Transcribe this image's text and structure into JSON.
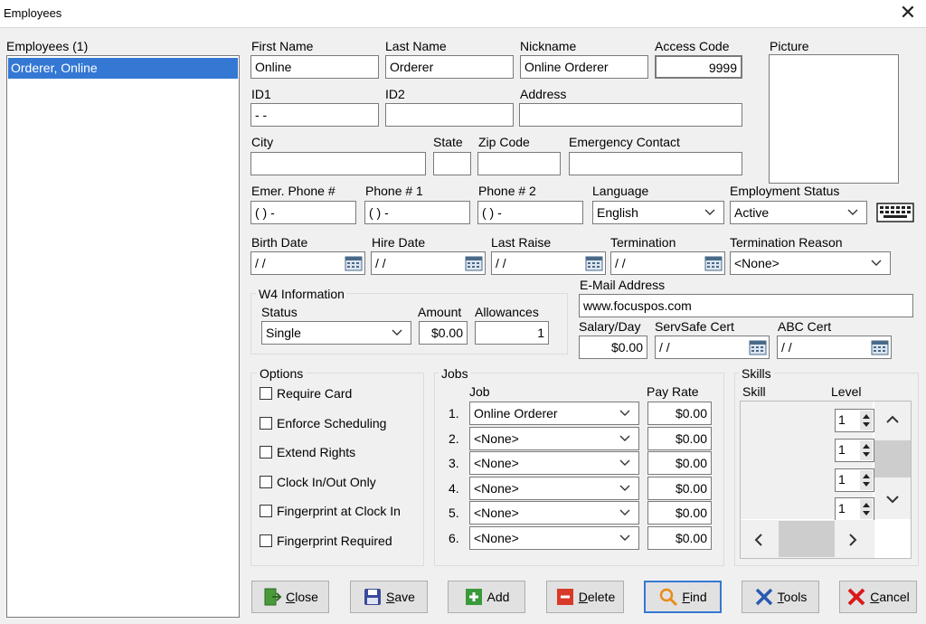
{
  "window": {
    "title": "Employees"
  },
  "employees_list": {
    "header": "Employees (1)",
    "items": [
      "Orderer, Online"
    ]
  },
  "form": {
    "first_name": {
      "label": "First Name",
      "value": "Online"
    },
    "last_name": {
      "label": "Last Name",
      "value": "Orderer"
    },
    "nickname": {
      "label": "Nickname",
      "value": "Online Orderer"
    },
    "access_code": {
      "label": "Access Code",
      "value": "9999"
    },
    "picture": {
      "label": "Picture"
    },
    "id1": {
      "label": "ID1",
      "value": " - -"
    },
    "id2": {
      "label": "ID2",
      "value": ""
    },
    "address": {
      "label": "Address",
      "value": ""
    },
    "city": {
      "label": "City",
      "value": ""
    },
    "state": {
      "label": "State",
      "value": ""
    },
    "zip": {
      "label": "Zip Code",
      "value": ""
    },
    "emergency_contact": {
      "label": "Emergency Contact",
      "value": ""
    },
    "emer_phone": {
      "label": "Emer. Phone #",
      "value": "(  )   -"
    },
    "phone1": {
      "label": "Phone # 1",
      "value": "(  )   -"
    },
    "phone2": {
      "label": "Phone # 2",
      "value": "(  )   -"
    },
    "language": {
      "label": "Language",
      "value": "English"
    },
    "employment_status": {
      "label": "Employment Status",
      "value": "Active"
    },
    "birth_date": {
      "label": "Birth Date",
      "value": " / /"
    },
    "hire_date": {
      "label": "Hire Date",
      "value": " / /"
    },
    "last_raise": {
      "label": "Last Raise",
      "value": " / /"
    },
    "termination": {
      "label": "Termination",
      "value": " / /"
    },
    "termination_reason": {
      "label": "Termination Reason",
      "value": "<None>"
    },
    "w4": {
      "title": "W4 Information",
      "status_label": "Status",
      "status_value": "Single",
      "amount_label": "Amount",
      "amount_value": "$0.00",
      "allowances_label": "Allowances",
      "allowances_value": "1"
    },
    "email": {
      "label": "E-Mail Address",
      "value": "www.focuspos.com"
    },
    "salary_day": {
      "label": "Salary/Day",
      "value": "$0.00"
    },
    "servsafe_cert": {
      "label": "ServSafe Cert",
      "value": " / /"
    },
    "abc_cert": {
      "label": "ABC Cert",
      "value": " / /"
    }
  },
  "options": {
    "title": "Options",
    "items": [
      "Require Card",
      "Enforce Scheduling",
      "Extend Rights",
      "Clock In/Out Only",
      "Fingerprint at Clock In",
      "Fingerprint Required"
    ]
  },
  "jobs": {
    "title": "Jobs",
    "job_header": "Job",
    "pay_header": "Pay Rate",
    "rows": [
      {
        "num": "1.",
        "job": "Online Orderer",
        "rate": "$0.00"
      },
      {
        "num": "2.",
        "job": "<None>",
        "rate": "$0.00"
      },
      {
        "num": "3.",
        "job": "<None>",
        "rate": "$0.00"
      },
      {
        "num": "4.",
        "job": "<None>",
        "rate": "$0.00"
      },
      {
        "num": "5.",
        "job": "<None>",
        "rate": "$0.00"
      },
      {
        "num": "6.",
        "job": "<None>",
        "rate": "$0.00"
      }
    ]
  },
  "skills": {
    "title": "Skills",
    "skill_header": "Skill",
    "level_header": "Level",
    "levels": [
      "1",
      "1",
      "1",
      "1"
    ]
  },
  "buttons": {
    "close": {
      "pre": "",
      "key": "C",
      "rest": "lose"
    },
    "save": {
      "pre": "",
      "key": "S",
      "rest": "ave"
    },
    "add": {
      "pre": "",
      "key": "",
      "rest": "Add"
    },
    "delete": {
      "pre": "",
      "key": "D",
      "rest": "elete"
    },
    "find": {
      "pre": "",
      "key": "F",
      "rest": "ind"
    },
    "tools": {
      "pre": "",
      "key": "T",
      "rest": "ools"
    },
    "cancel": {
      "pre": "",
      "key": "C",
      "rest": "ancel"
    }
  },
  "colors": {
    "selection": "#3478d4",
    "focus": "#3478d4"
  }
}
